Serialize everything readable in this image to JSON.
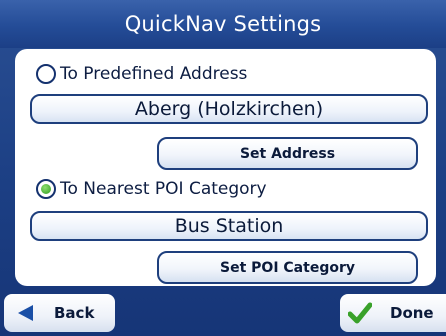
{
  "header": {
    "title": "QuickNav Settings"
  },
  "options": {
    "predefined": {
      "label": "To Predefined Address",
      "selected": false
    },
    "poi": {
      "label": "To Nearest POI Category",
      "selected": true
    }
  },
  "fields": {
    "address": "Aberg (Holzkirchen)",
    "poi_category": "Bus Station"
  },
  "buttons": {
    "set_address": "Set Address",
    "set_poi": "Set POI Category",
    "back": "Back",
    "done": "Done"
  },
  "icons": {
    "back": "back-arrow-icon",
    "done": "checkmark-icon"
  },
  "colors": {
    "header_blue": "#244c97",
    "radio_selected": "#2e9a1f",
    "check_green": "#39a12a",
    "arrow_blue": "#1a4fa6"
  }
}
